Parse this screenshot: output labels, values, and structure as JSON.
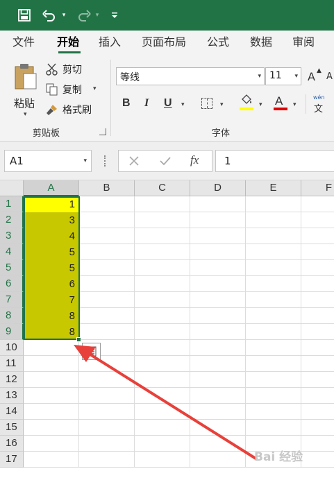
{
  "quick_access": {
    "save_icon": "save-icon",
    "undo_icon": "undo-icon",
    "redo_icon": "redo-icon",
    "customize_icon": "customize-qat-icon"
  },
  "tabs": [
    {
      "label": "文件"
    },
    {
      "label": "开始",
      "active": true
    },
    {
      "label": "插入"
    },
    {
      "label": "页面布局"
    },
    {
      "label": "公式"
    },
    {
      "label": "数据"
    },
    {
      "label": "审阅"
    }
  ],
  "ribbon": {
    "clipboard": {
      "paste_label": "粘贴",
      "cut_label": "剪切",
      "copy_label": "复制",
      "format_painter_label": "格式刷",
      "group_label": "剪贴板"
    },
    "font": {
      "font_name": "等线",
      "font_size": "11",
      "bold_label": "B",
      "italic_label": "I",
      "underline_label": "U",
      "font_color_label": "A",
      "grow_font_label": "A",
      "shrink_font_label": "A",
      "phonetic_label": "wén",
      "phonetic_char": "文",
      "group_label": "字体",
      "highlight_color": "#ffff00",
      "font_color": "#e00000"
    }
  },
  "formula_bar": {
    "name_box": "A1",
    "cancel_icon": "cancel-icon",
    "enter_icon": "enter-icon",
    "fx_label": "fx",
    "value": "1"
  },
  "sheet": {
    "columns": [
      "A",
      "B",
      "C",
      "D",
      "E",
      "F"
    ],
    "rows": [
      "1",
      "2",
      "3",
      "4",
      "5",
      "6",
      "7",
      "8",
      "9",
      "10",
      "11",
      "12",
      "13",
      "14",
      "15",
      "16",
      "17"
    ],
    "column_a_values": [
      "1",
      "3",
      "4",
      "5",
      "5",
      "6",
      "7",
      "8",
      "8"
    ],
    "selected_range": "A1:A9",
    "active_cell_fill": "#ffff00",
    "range_fill": "#c8c800",
    "accent": "#217346"
  },
  "annotation": {
    "arrow_color": "#e8403a"
  },
  "watermark": "Bai 经验"
}
